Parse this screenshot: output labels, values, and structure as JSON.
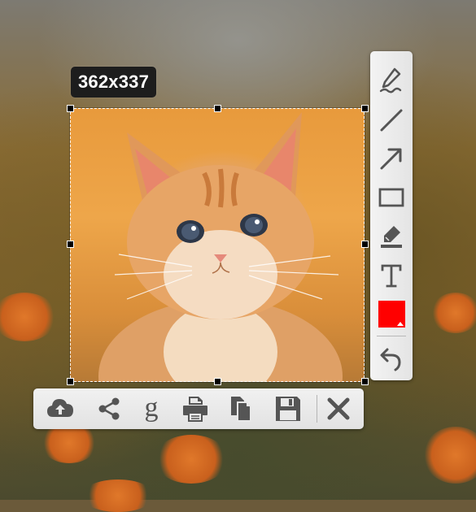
{
  "selection": {
    "size_label": "362x337"
  },
  "tools": [
    {
      "name": "pencil"
    },
    {
      "name": "line"
    },
    {
      "name": "arrow"
    },
    {
      "name": "rectangle"
    },
    {
      "name": "marker"
    },
    {
      "name": "text"
    },
    {
      "name": "color",
      "value": "#ff0000"
    },
    {
      "name": "undo"
    }
  ],
  "actions": [
    {
      "name": "upload"
    },
    {
      "name": "share"
    },
    {
      "name": "google-search"
    },
    {
      "name": "print"
    },
    {
      "name": "copy"
    },
    {
      "name": "save"
    },
    {
      "name": "close"
    }
  ],
  "colors": {
    "selected_color": "#ff0000",
    "icon": "#555555"
  }
}
